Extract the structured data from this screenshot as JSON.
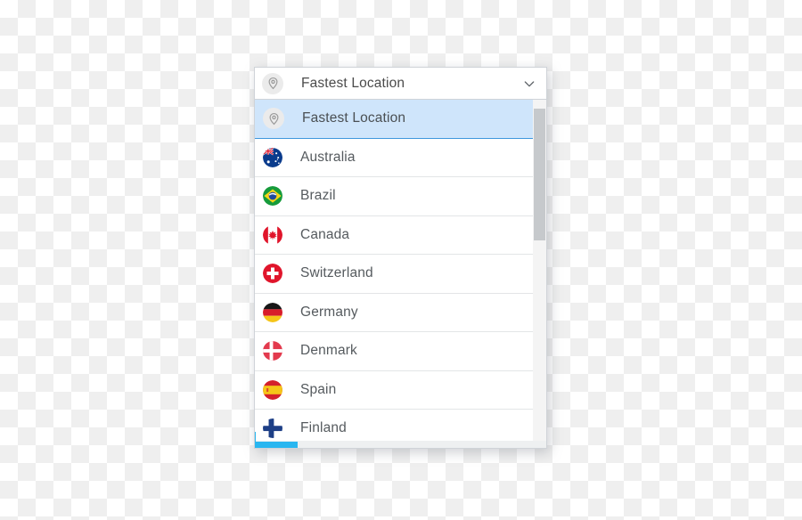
{
  "widget": {
    "type": "location-select-dropdown",
    "header": {
      "value": "Fastest Location",
      "icon": "location-pin-icon",
      "expander_icon": "chevron-down-icon"
    },
    "accent_color": "#3e97dd",
    "selected_row_background": "#cfe5fb",
    "text_color": "#555a5e",
    "options": [
      {
        "label": "Fastest Location",
        "icon": "location-pin-icon",
        "selected": true
      },
      {
        "label": "Australia",
        "icon": "flag-australia-icon",
        "selected": false
      },
      {
        "label": "Brazil",
        "icon": "flag-brazil-icon",
        "selected": false
      },
      {
        "label": "Canada",
        "icon": "flag-canada-icon",
        "selected": false
      },
      {
        "label": "Switzerland",
        "icon": "flag-switzerland-icon",
        "selected": false
      },
      {
        "label": "Germany",
        "icon": "flag-germany-icon",
        "selected": false
      },
      {
        "label": "Denmark",
        "icon": "flag-denmark-icon",
        "selected": false
      },
      {
        "label": "Spain",
        "icon": "flag-spain-icon",
        "selected": false
      },
      {
        "label": "Finland",
        "icon": "flag-finland-icon",
        "selected": false
      }
    ],
    "vertical_scrollbar": {
      "name": "vertical-scrollbar",
      "thumb_color": "#c6c9cc"
    },
    "horizontal_scrollbar": {
      "name": "horizontal-scrollbar",
      "thumb_color": "#29b6f0"
    }
  }
}
